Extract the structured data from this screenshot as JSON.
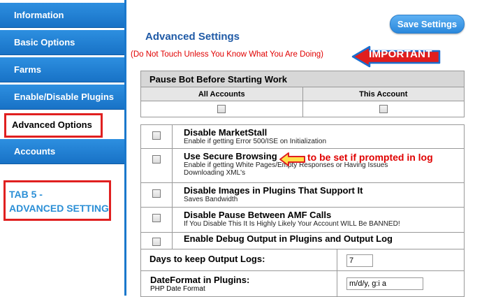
{
  "sidebar": {
    "tabs": [
      {
        "label": "Information"
      },
      {
        "label": "Basic Options"
      },
      {
        "label": "Farms"
      },
      {
        "label": "Enable/Disable Plugins"
      },
      {
        "label": "Advanced Options"
      },
      {
        "label": "Accounts"
      }
    ],
    "active_tab": "Advanced Options",
    "annotation": {
      "line1": "TAB 5 -",
      "line2": "ADVANCED SETTING"
    }
  },
  "header": {
    "save_button": "Save Settings",
    "title": "Advanced Settings",
    "warning": "(Do Not Touch Unless You Know What You Are Doing)",
    "important_label": "IMPORTANT"
  },
  "pause_bot": {
    "header": "Pause Bot Before Starting Work",
    "columns": [
      "All Accounts",
      "This Account"
    ]
  },
  "options": [
    {
      "title": "Disable MarketStall",
      "desc": "Enable if getting Error 500/ISE on Initialization"
    },
    {
      "title": "Use Secure Browsing",
      "desc": "Enable if getting White Pages/Empty Responses or Having Issues Downloading XML's"
    },
    {
      "title": "Disable Images in Plugins That Support It",
      "desc": "Saves Bandwidth"
    },
    {
      "title": "Disable Pause Between AMF Calls",
      "desc": "If You Disable This It Is Highly Likely Your Account WILL Be BANNED!"
    },
    {
      "title": "Enable Debug Output in Plugins and Output Log",
      "desc": ""
    }
  ],
  "output_logs": {
    "days_label": "Days to keep Output Logs:",
    "days_value": "7",
    "dateformat_label": "DateFormat in Plugins:",
    "dateformat_desc": "PHP Date Format",
    "dateformat_value": "m/d/y, g:i a"
  },
  "annotations": {
    "secure_note": "to be set if prompted in log"
  },
  "colors": {
    "tab_blue": "#1f7fd6",
    "annotation_red": "#e02020",
    "title_blue": "#1f5aa6"
  }
}
